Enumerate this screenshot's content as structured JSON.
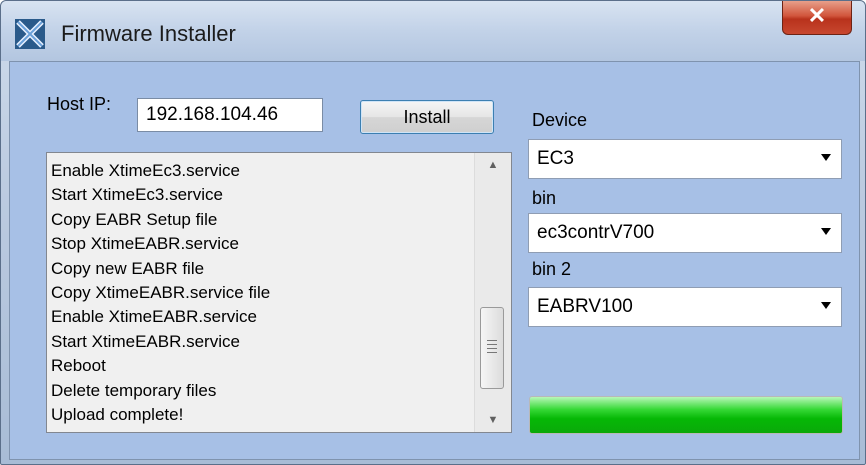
{
  "window": {
    "title": "Firmware Installer"
  },
  "host": {
    "label": "Host IP:",
    "value": "192.168.104.46"
  },
  "install_label": "Install",
  "log": {
    "lines": [
      "Enable XtimeEc3.service",
      "Start XtimeEc3.service",
      "Copy  EABR Setup file",
      "Stop XtimeEABR.service",
      "Copy new EABR file",
      "Copy XtimeEABR.service file",
      "Enable XtimeEABR.service",
      "Start XtimeEABR.service",
      "Reboot",
      "Delete temporary files",
      "Upload complete!"
    ]
  },
  "device": {
    "label": "Device",
    "value": "EC3"
  },
  "bin": {
    "label": "bin",
    "value": "ec3contrV700"
  },
  "bin2": {
    "label": "bin 2",
    "value": "EABRV100"
  },
  "progress": {
    "percent": 100
  },
  "icons": {
    "app": "x-logo-icon",
    "close": "close-icon",
    "dropdown": "chevron-down-icon"
  }
}
